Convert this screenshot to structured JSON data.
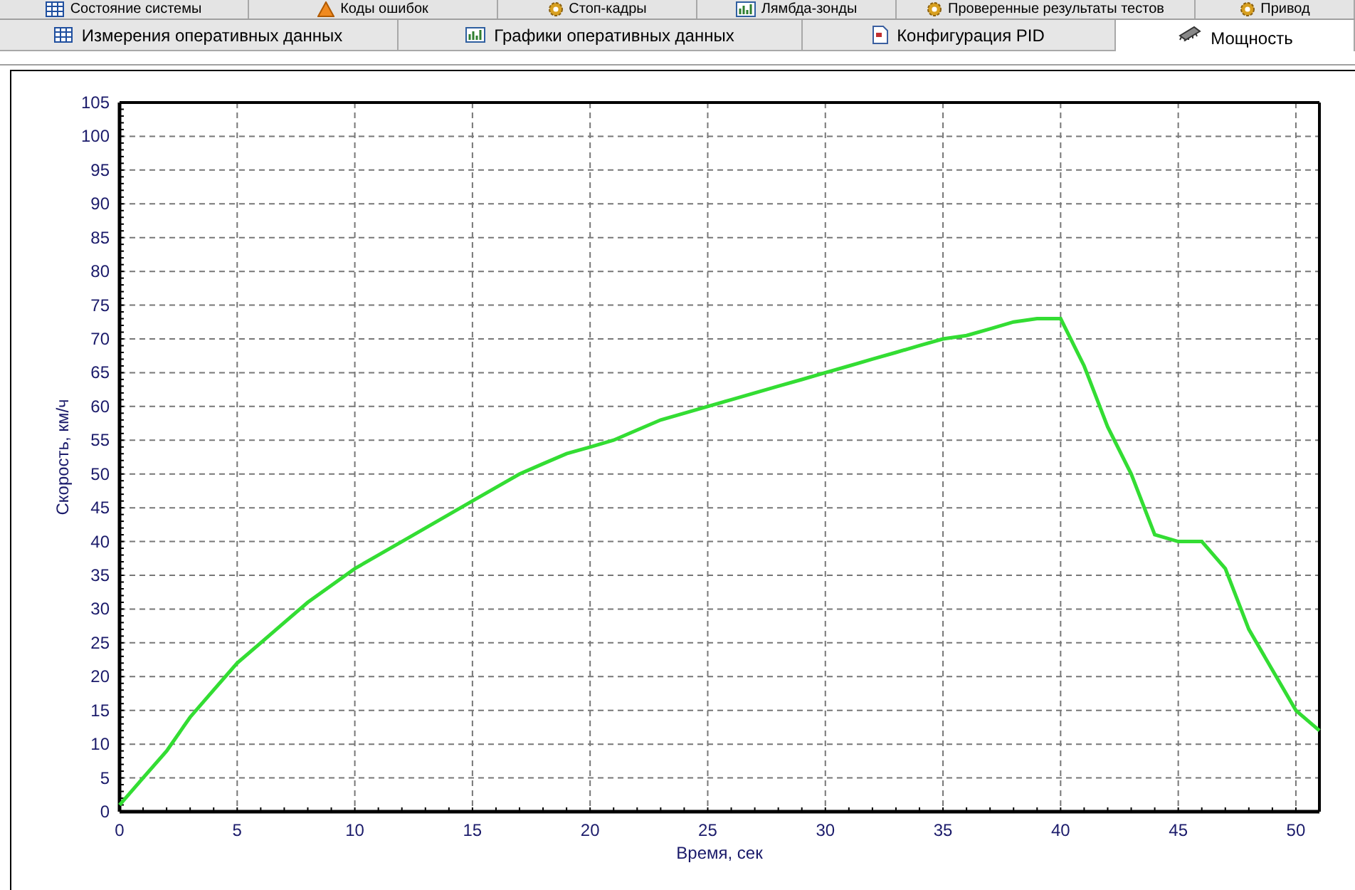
{
  "top_tabs": [
    {
      "label": "Состояние системы",
      "kind": "grid",
      "selected": false
    },
    {
      "label": "Коды ошибок",
      "kind": "warning",
      "selected": false
    },
    {
      "label": "Стоп-кадры",
      "kind": "gear",
      "selected": false
    },
    {
      "label": "Лямбда-зонды",
      "kind": "chart",
      "selected": false
    },
    {
      "label": "Проверенные результаты тестов",
      "kind": "gear",
      "selected": false
    },
    {
      "label": "Привод",
      "kind": "gear",
      "selected": false
    }
  ],
  "tabs": [
    {
      "label": "Измерения оперативных данных",
      "kind": "grid",
      "selected": false
    },
    {
      "label": "Графики оперативных данных",
      "kind": "chart",
      "selected": false
    },
    {
      "label": "Конфигурация PID",
      "kind": "doc",
      "selected": false
    },
    {
      "label": "Мощность",
      "kind": "chip",
      "selected": true
    }
  ],
  "chart_data": {
    "type": "line",
    "grid": true,
    "xlabel": "Время, сек",
    "ylabel": "Скорость, км/ч",
    "xlim": [
      0,
      51
    ],
    "ylim": [
      0,
      105
    ],
    "xticks": [
      0,
      5,
      10,
      15,
      20,
      25,
      30,
      35,
      40,
      45,
      50
    ],
    "yticks": [
      0,
      5,
      10,
      15,
      20,
      25,
      30,
      35,
      40,
      45,
      50,
      55,
      60,
      65,
      70,
      75,
      80,
      85,
      90,
      95,
      100,
      105
    ],
    "x": [
      0,
      1,
      2,
      3,
      4,
      5,
      6,
      7,
      8,
      9,
      10,
      11,
      12,
      13,
      14,
      15,
      16,
      17,
      18,
      19,
      20,
      21,
      22,
      23,
      24,
      25,
      26,
      27,
      28,
      29,
      30,
      31,
      32,
      33,
      34,
      35,
      36,
      37,
      38,
      39,
      40,
      41,
      42,
      43,
      44,
      45,
      46,
      47,
      48,
      49,
      50,
      51
    ],
    "series": [
      {
        "color": "#33dd33",
        "values": [
          1,
          5,
          9,
          14,
          18,
          22,
          25,
          28,
          31,
          33.5,
          36,
          38,
          40,
          42,
          44,
          46,
          48,
          50,
          51.5,
          53,
          54,
          55,
          56.5,
          58,
          59,
          60,
          61,
          62,
          63,
          64,
          65,
          66,
          67,
          68,
          69,
          70,
          70.5,
          71.5,
          72.5,
          73,
          73,
          66,
          57,
          50,
          41,
          40,
          40,
          36,
          27,
          21,
          15,
          12
        ]
      }
    ]
  }
}
